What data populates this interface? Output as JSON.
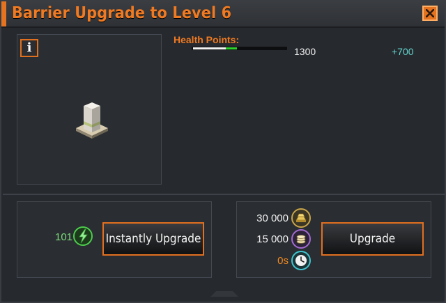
{
  "window": {
    "title": "Barrier Upgrade to Level 6",
    "accent_color": "#f07a22",
    "close_icon": "close-icon"
  },
  "preview": {
    "info_label": "i",
    "building_icon": "barrier-building-icon"
  },
  "stats": {
    "health_label": "Health Points:",
    "health_value": "1300",
    "health_increase": "+700",
    "health_fraction": 0.47,
    "health_gain_fraction": 0.12
  },
  "instant": {
    "gem_cost": "101",
    "gem_icon": "gem-icon",
    "button_label": "Instantly Upgrade"
  },
  "upgrade": {
    "costs": [
      {
        "value": "30 000",
        "icon": "gold-bars-icon",
        "color": "#f0f0f0"
      },
      {
        "value": "15 000",
        "icon": "coins-icon",
        "color": "#f0f0f0"
      },
      {
        "value": "0s",
        "icon": "clock-icon",
        "color": "#f08a22"
      }
    ],
    "button_label": "Upgrade"
  }
}
